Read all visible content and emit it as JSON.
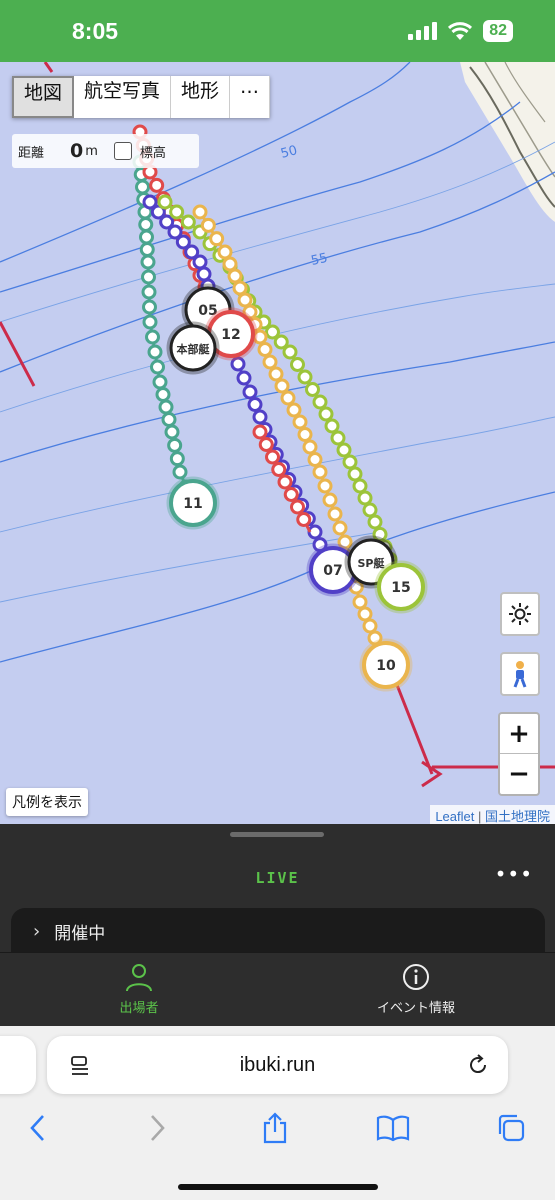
{
  "status": {
    "time": "8:05",
    "battery": "82"
  },
  "map": {
    "layers": [
      "地図",
      "航空写真",
      "地形",
      "…"
    ],
    "active_layer": "地図",
    "distance_label": "距離",
    "distance_value": "0",
    "distance_unit": "m",
    "elevation_label": "標高",
    "contours": [
      "50",
      "55"
    ],
    "markers": [
      "05",
      "12",
      "本部艇",
      "11",
      "07",
      "SP艇",
      "15",
      "10"
    ],
    "legend_button": "凡例を表示",
    "attribution_leaflet": "Leaflet",
    "attribution_gsi": "国土地理院",
    "zoom_in": "+",
    "zoom_out": "−"
  },
  "sheet": {
    "live": "LIVE",
    "more": "•••",
    "event_status": "開催中",
    "tabs": [
      {
        "label": "出場者"
      },
      {
        "label": "イベント情報"
      }
    ]
  },
  "browser": {
    "url": "ibuki.run"
  },
  "colors": {
    "header_green": "#4caf50",
    "teal": "#4aa58e",
    "purple": "#5140c7",
    "red": "#e04a4a",
    "lime": "#9cc43a",
    "orange": "#eab54d",
    "black_boat": "#222222",
    "course_line": "#cc2b4a"
  }
}
